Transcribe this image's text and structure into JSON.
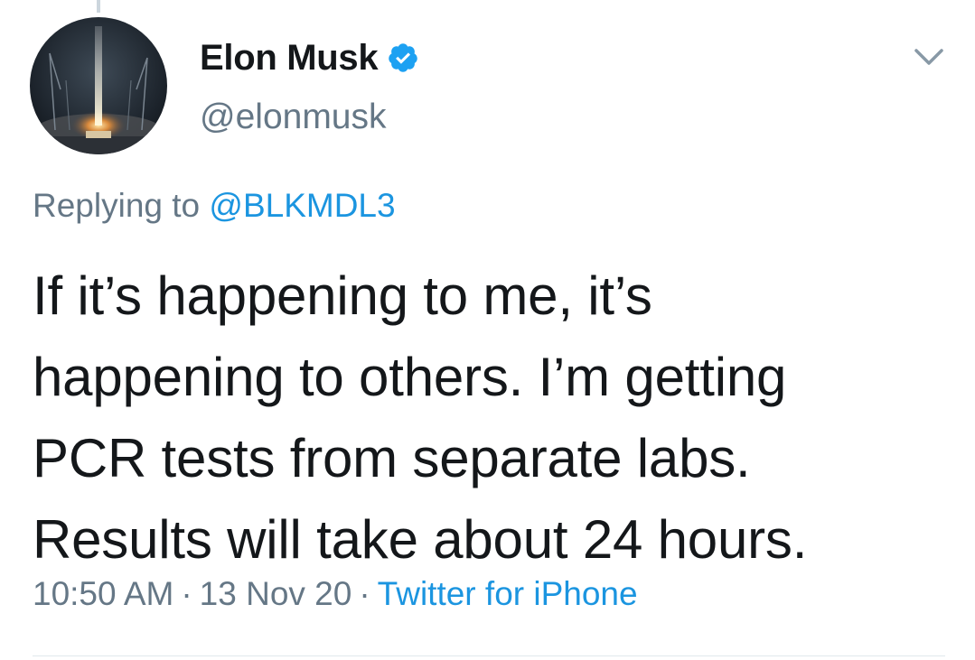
{
  "author": {
    "name": "Elon Musk",
    "handle": "@elonmusk",
    "verified": true
  },
  "reply": {
    "prefix": "Replying to",
    "handle": "@BLKMDL3"
  },
  "tweet": {
    "text_lines": [
      "If it’s happening to me, it’s",
      "happening to others. I’m getting",
      "PCR tests from separate labs.",
      "Results will take about 24 hours."
    ]
  },
  "meta": {
    "time": "10:50 AM",
    "date": "13 Nov 20",
    "separator": "·",
    "source": "Twitter for iPhone"
  },
  "icons": {
    "verified": "verified-badge-icon",
    "menu": "chevron-down-icon"
  },
  "colors": {
    "link": "#1b95e0",
    "secondary_text": "#657786",
    "verified": "#1da1f2",
    "primary_text": "#14171a"
  }
}
